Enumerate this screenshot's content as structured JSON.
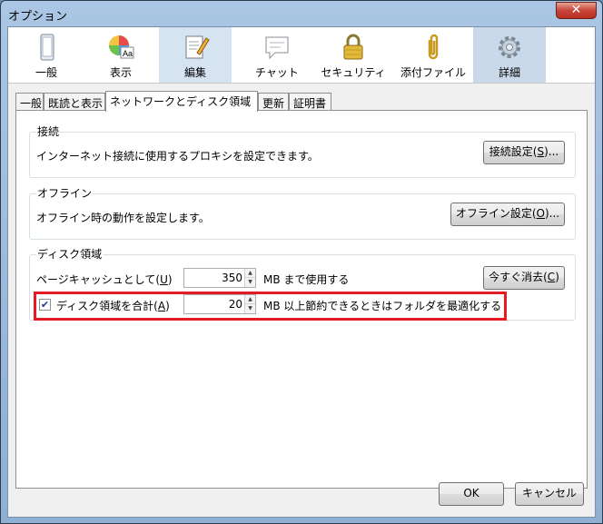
{
  "window": {
    "title": "オプション",
    "close_glyph": "✕"
  },
  "toolbar": {
    "items": [
      {
        "label": "一般",
        "icon": "window-icon"
      },
      {
        "label": "表示",
        "icon": "color-wheel-icon"
      },
      {
        "label": "編集",
        "icon": "edit-pencil-icon"
      },
      {
        "label": "チャット",
        "icon": "chat-bubble-icon"
      },
      {
        "label": "セキュリティ",
        "icon": "padlock-icon"
      },
      {
        "label": "添付ファイル",
        "icon": "paperclip-icon"
      },
      {
        "label": "詳細",
        "icon": "gear-icon"
      }
    ]
  },
  "tabs": [
    "一般",
    "既読と表示",
    "ネットワークとディスク領域",
    "更新",
    "証明書"
  ],
  "connection": {
    "title": "接続",
    "description": "インターネット接続に使用するプロキシを設定できます。",
    "button_prefix": "接続設定(",
    "button_key": "S",
    "button_suffix": ")..."
  },
  "offline": {
    "title": "オフライン",
    "description": "オフライン時の動作を設定します。",
    "button_prefix": "オフライン設定(",
    "button_key": "O",
    "button_suffix": ")..."
  },
  "disk": {
    "title": "ディスク領域",
    "cache_label_prefix": "ページキャッシュとして(",
    "cache_label_key": "U",
    "cache_label_suffix": ")",
    "cache_value": "350",
    "cache_unit": "MB まで使用する",
    "clear_prefix": "今すぐ消去(",
    "clear_key": "C",
    "clear_suffix": ")",
    "compact_checked": true,
    "compact_check_glyph": "✔",
    "compact_label_prefix": "ディスク領域を合計(",
    "compact_label_key": "A",
    "compact_label_suffix": ")",
    "compact_value": "20",
    "compact_unit": "MB 以上節約できるときはフォルダを最適化する"
  },
  "spinner": {
    "up": "▲",
    "down": "▼"
  },
  "footer": {
    "ok": "OK",
    "cancel": "キャンセル"
  },
  "colors": {
    "highlight": "#e41b22",
    "selected_tab": "#cad9ea"
  }
}
